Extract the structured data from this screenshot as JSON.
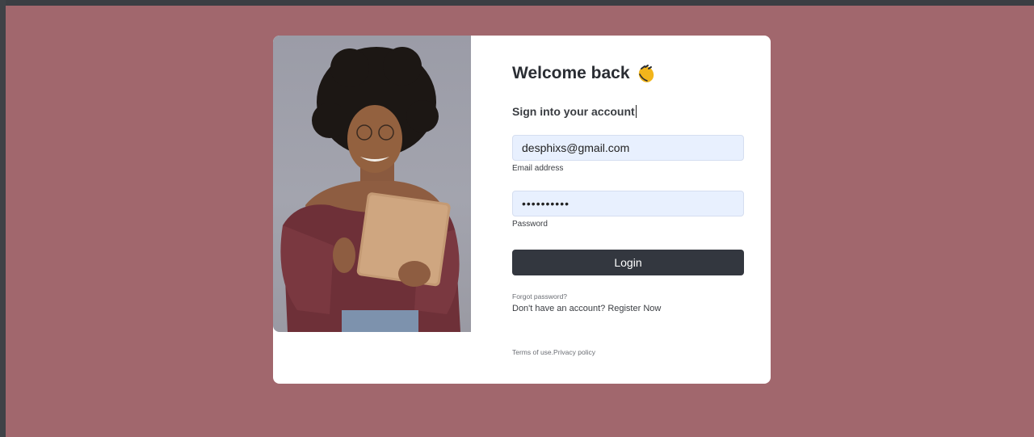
{
  "login": {
    "title": "Welcome back",
    "greeting_icon": "waving-hand-icon",
    "subtitle": "Sign into your account",
    "email_value": "desphixs@gmail.com",
    "email_label": "Email address",
    "password_value": "••••••••••",
    "password_label": "Password",
    "login_button": "Login",
    "forgot_password": "Forgot password?",
    "register_prompt": "Don't have an account?",
    "register_link": "Register Now",
    "terms_link": "Terms of use.",
    "privacy_link": "Privacy policy"
  },
  "colors": {
    "page_background": "#a1676d",
    "button": "#33373f",
    "input_fill": "#e8f0fe"
  }
}
